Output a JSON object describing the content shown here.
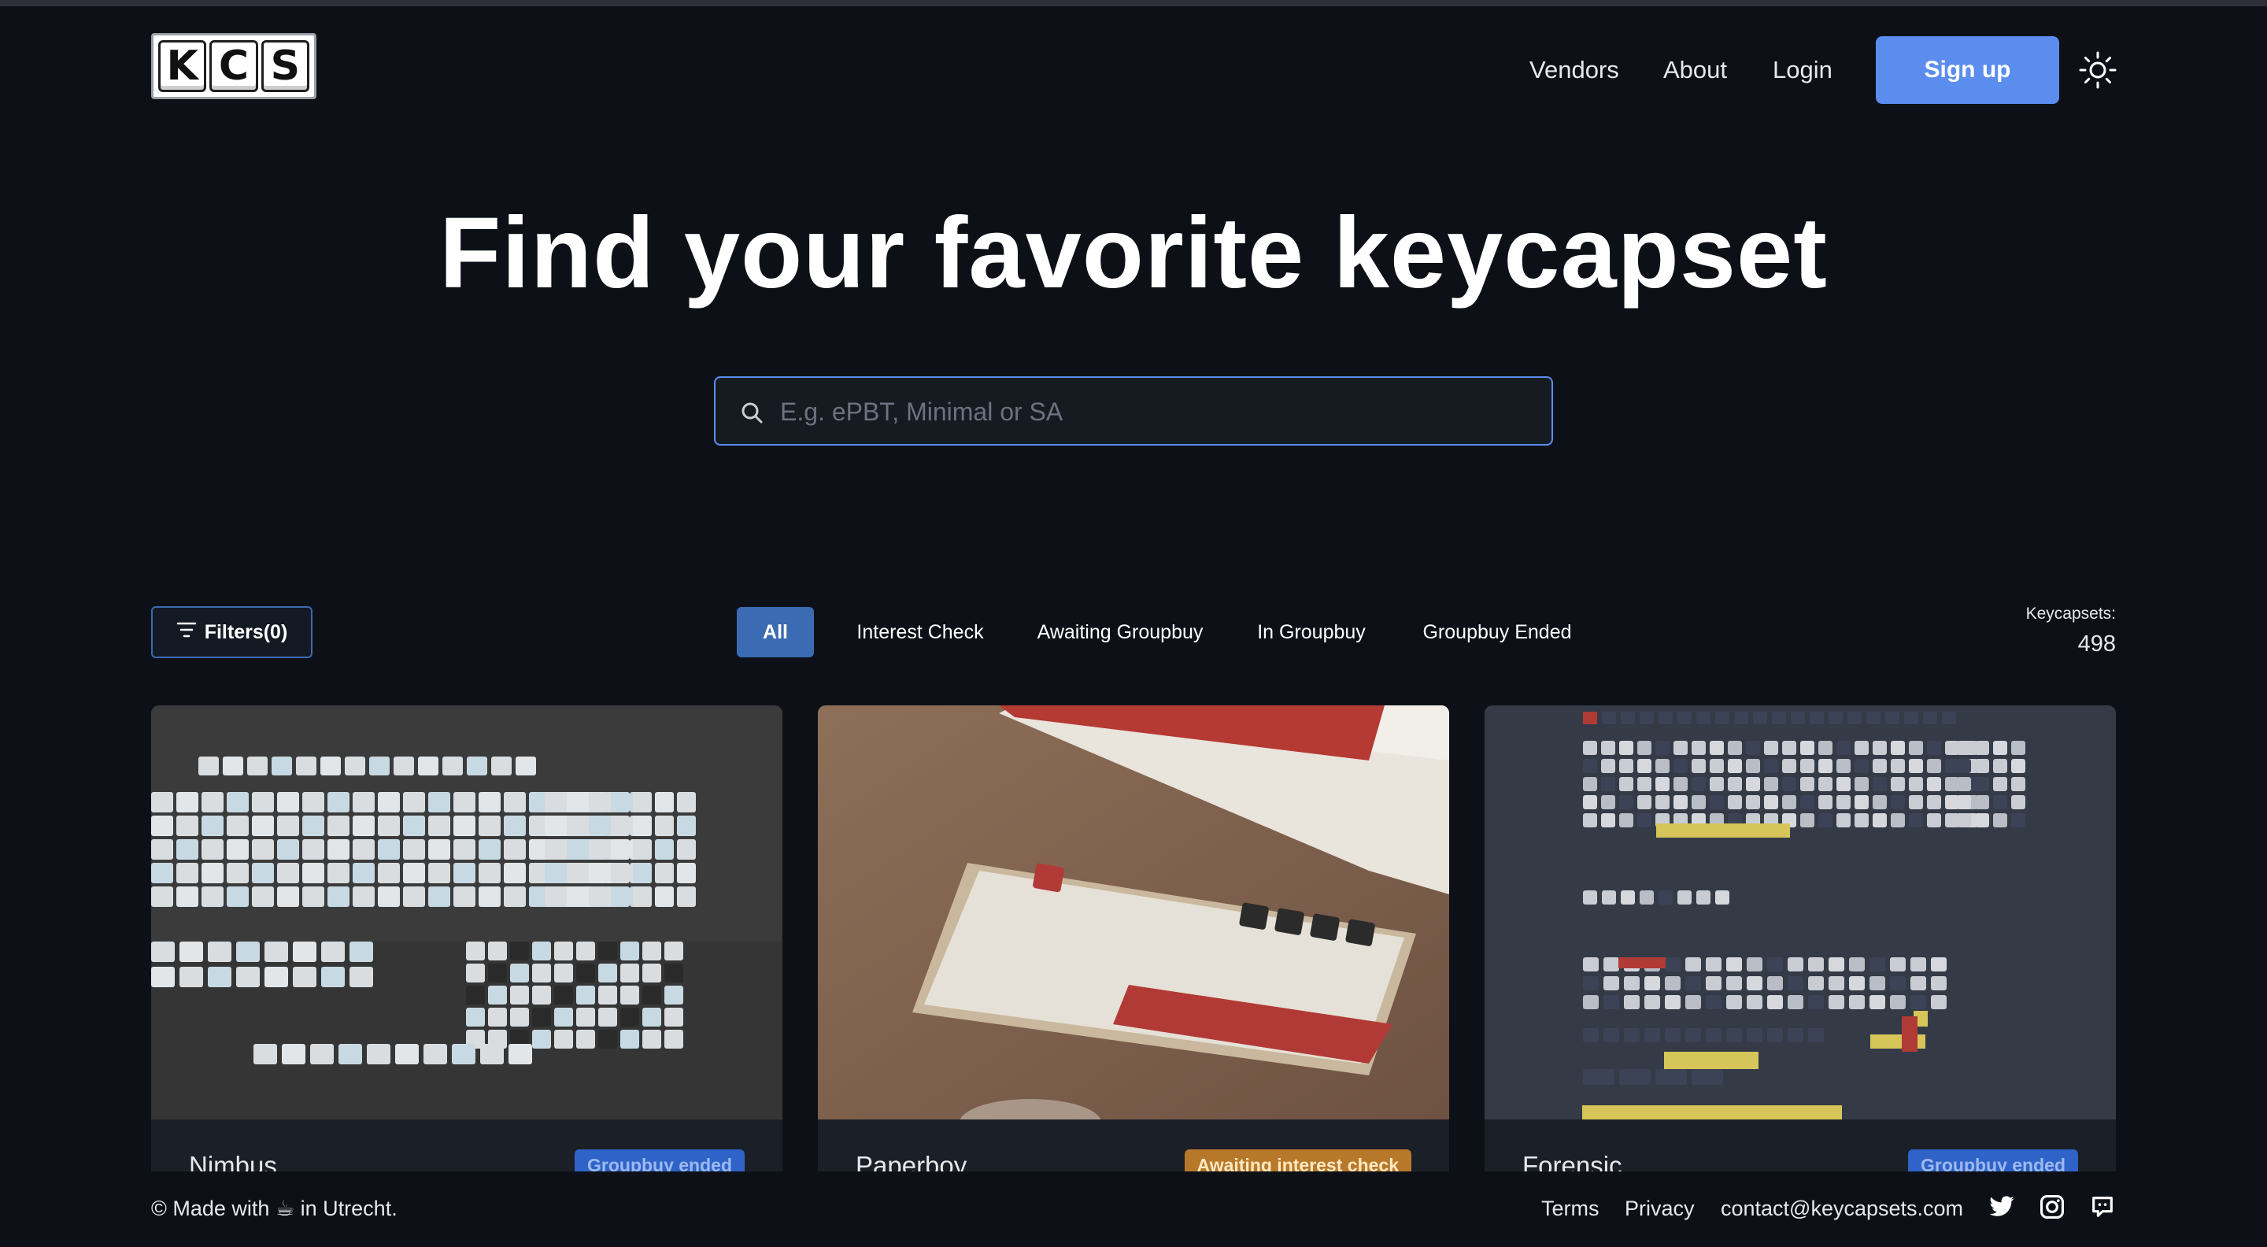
{
  "header": {
    "logo_letters": [
      "K",
      "C",
      "S"
    ],
    "nav": {
      "vendors": "Vendors",
      "about": "About",
      "login": "Login"
    },
    "signup_label": "Sign up",
    "theme_icon": "sun-icon"
  },
  "hero": {
    "title": "Find your favorite keycapset",
    "search_placeholder": "E.g. ePBT, Minimal or SA"
  },
  "filters": {
    "button_label": "Filters(0)",
    "tabs": [
      "All",
      "Interest Check",
      "Awaiting Groupbuy",
      "In Groupbuy",
      "Groupbuy Ended"
    ],
    "active_tab": "All",
    "count_label": "Keycapsets:",
    "count_value": "498"
  },
  "cards": [
    {
      "title": "Nimbus",
      "badge": "Groupbuy ended",
      "badge_bg": "#2f63c7",
      "badge_color": "#9db9f0"
    },
    {
      "title": "Paperboy",
      "badge": "Awaiting interest check",
      "badge_bg": "#b8782a",
      "badge_color": "#ffe8c2"
    },
    {
      "title": "Forensic",
      "badge": "Groupbuy ended",
      "badge_bg": "#2f63c7",
      "badge_color": "#9db9f0"
    }
  ],
  "footer": {
    "made_with": "© Made with ☕ in Utrecht.",
    "terms": "Terms",
    "privacy": "Privacy",
    "contact": "contact@keycapsets.com",
    "social_icons": [
      "twitter-icon",
      "instagram-icon",
      "discord-icon"
    ]
  },
  "colors": {
    "accent": "#5b8def",
    "background": "#0d1117",
    "active_tab": "#3b6bb3"
  }
}
